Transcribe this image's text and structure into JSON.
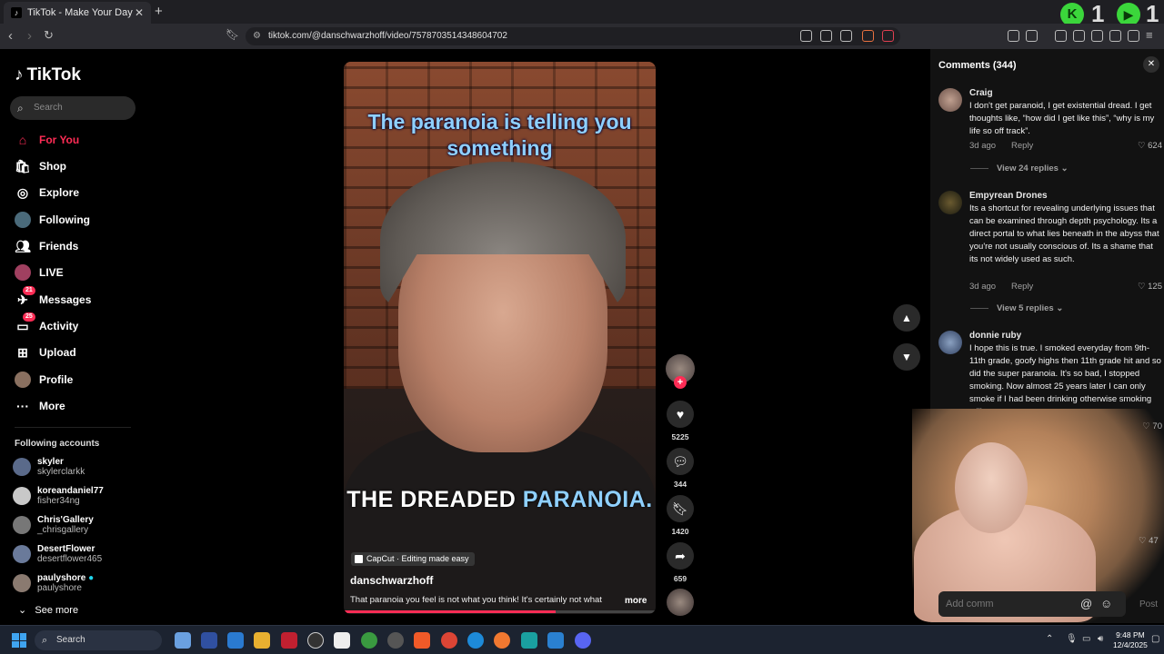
{
  "browser": {
    "tab_title": "TikTok - Make Your Day",
    "url": "tiktok.com/@danschwarzhoff/video/7578703514348604702",
    "overlay_counts": [
      "1",
      "1"
    ]
  },
  "sidebar": {
    "logo": "TikTok",
    "search_placeholder": "Search",
    "nav": [
      {
        "label": "For You",
        "icon": "home-icon",
        "badge": ""
      },
      {
        "label": "Shop",
        "icon": "shop-icon",
        "badge": ""
      },
      {
        "label": "Explore",
        "icon": "compass-icon",
        "badge": ""
      },
      {
        "label": "Following",
        "icon": "following-avatar-icon",
        "badge": ""
      },
      {
        "label": "Friends",
        "icon": "friends-icon",
        "badge": ""
      },
      {
        "label": "LIVE",
        "icon": "live-icon",
        "badge": ""
      },
      {
        "label": "Messages",
        "icon": "messages-icon",
        "badge": "21"
      },
      {
        "label": "Activity",
        "icon": "activity-icon",
        "badge": "25"
      },
      {
        "label": "Upload",
        "icon": "upload-icon",
        "badge": ""
      },
      {
        "label": "Profile",
        "icon": "profile-avatar-icon",
        "badge": ""
      },
      {
        "label": "More",
        "icon": "more-icon",
        "badge": ""
      }
    ],
    "following_header": "Following accounts",
    "following": [
      {
        "name": "skyler",
        "handle": "skylerclarkk"
      },
      {
        "name": "koreandaniel77",
        "handle": "fisher34ng"
      },
      {
        "name": "Chris'Gallery",
        "handle": "_chrisgallery"
      },
      {
        "name": "DesertFlower",
        "handle": "desertflower465"
      },
      {
        "name": "paulyshore",
        "handle": "paulyshore"
      }
    ],
    "see_more": "See more"
  },
  "video": {
    "caption_top": "The paranoia is telling you something",
    "caption_bottom_1": "THE DREADED",
    "caption_bottom_2": "PARANOIA.",
    "capcut": "CapCut · Editing made easy",
    "author": "danschwarzhoff",
    "description": "That paranoia you feel is not what you think! It's certainly not what",
    "more": "more",
    "progress": 0.68
  },
  "actions": {
    "likes": "5225",
    "comments": "344",
    "saves": "1420",
    "shares": "659"
  },
  "comments_panel": {
    "title": "Comments (344)",
    "comments": [
      {
        "name": "Craig",
        "text": "I don't get paranoid, I get existential dread. I get thoughts like, “how did I get like this”, “why is my life so off track”.",
        "time": "3d ago",
        "reply": "Reply",
        "likes": "624",
        "view_replies": "View 24 replies"
      },
      {
        "name": "Empyrean Drones",
        "text": "Its a shortcut for revealing underlying issues that can be examined through depth psychology. Its a direct portal to what lies beneath in the abyss that you're not usually conscious of. Its a shame that its not widely used as such.",
        "time": "3d ago",
        "reply": "Reply",
        "likes": "125",
        "view_replies": "View 5 replies"
      },
      {
        "name": "donnie ruby",
        "text": "I hope this is true. I smoked everyday from 9th-11th grade, goofy highs then 11th grade hit and so did the super paranoia. It's so bad, I stopped smoking. Now almost 25 years later I can only smoke if I had been drinking otherwise smoking still",
        "likes": "70"
      }
    ],
    "hidden_likes": "47",
    "add_comment_placeholder": "Add comm",
    "post": "Post"
  },
  "taskbar": {
    "search": "Search",
    "time": "9:48 PM",
    "date": "12/4/2025"
  }
}
